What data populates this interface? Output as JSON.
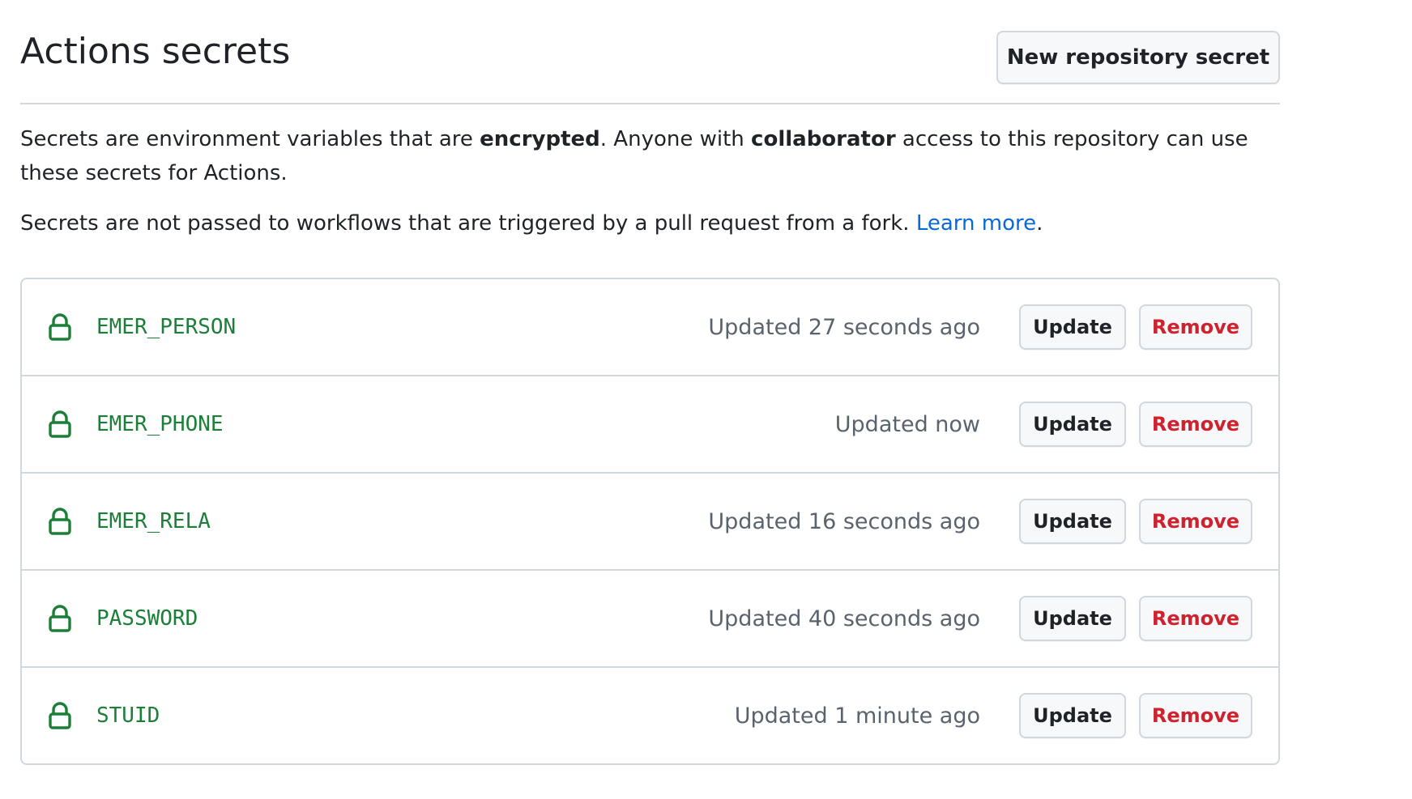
{
  "page": {
    "title": "Actions secrets",
    "new_secret_label": "New repository secret"
  },
  "description": {
    "line1_part1": "Secrets are environment variables that are ",
    "line1_bold1": "encrypted",
    "line1_part2": ". Anyone with ",
    "line1_bold2": "collaborator",
    "line1_part3": " access to this repository can use these secrets for Actions.",
    "line2_text": "Secrets are not passed to workflows that are triggered by a pull request from a fork. ",
    "line2_link": "Learn more",
    "line2_end": "."
  },
  "colors": {
    "secret_name": "#1a7f37",
    "remove_text": "#cf222e",
    "link": "#0969da",
    "border": "#d0d7de"
  },
  "secrets": [
    {
      "name": "EMER_PERSON",
      "updated": "Updated 27 seconds ago",
      "update_label": "Update",
      "remove_label": "Remove",
      "icon": "lock-icon"
    },
    {
      "name": "EMER_PHONE",
      "updated": "Updated now",
      "update_label": "Update",
      "remove_label": "Remove",
      "icon": "lock-icon"
    },
    {
      "name": "EMER_RELA",
      "updated": "Updated 16 seconds ago",
      "update_label": "Update",
      "remove_label": "Remove",
      "icon": "lock-icon"
    },
    {
      "name": "PASSWORD",
      "updated": "Updated 40 seconds ago",
      "update_label": "Update",
      "remove_label": "Remove",
      "icon": "lock-icon"
    },
    {
      "name": "STUID",
      "updated": "Updated 1 minute ago",
      "update_label": "Update",
      "remove_label": "Remove",
      "icon": "lock-icon"
    }
  ]
}
